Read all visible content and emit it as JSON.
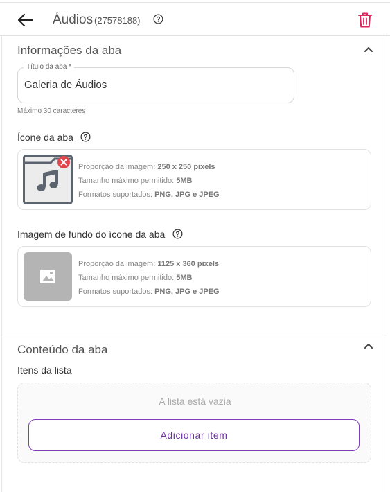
{
  "header": {
    "title": "Áudios",
    "id": "(27578188)"
  },
  "tab_info": {
    "title": "Informações da aba",
    "name_field": {
      "legend": "Título da aba *",
      "value": "Galeria de Áudios",
      "hint": "Máximo 30 caracteres"
    },
    "icon": {
      "label": "Ícone da aba",
      "specs": {
        "ratio_label": "Proporção da imagem: ",
        "ratio_value": "250 x 250 pixels",
        "size_label": "Tamanho máximo permitido: ",
        "size_value": "5MB",
        "formats_label": "Formatos suportados: ",
        "formats_value": "PNG, JPG e JPEG"
      }
    },
    "background": {
      "label": "Imagem de fundo do ícone da aba",
      "specs": {
        "ratio_label": "Proporção da imagem: ",
        "ratio_value": "1125 x 360 pixels",
        "size_label": "Tamanho máximo permitido: ",
        "size_value": "5MB",
        "formats_label": "Formatos suportados: ",
        "formats_value": "PNG, JPG e JPEG"
      }
    }
  },
  "tab_content": {
    "title": "Conteúdo da aba",
    "list_label": "Itens da lista",
    "empty_text": "A lista está vazia",
    "add_button": "Adicionar item"
  },
  "colors": {
    "accent": "#6d2fa5",
    "danger": "#e0245e",
    "remove_badge": "#e0474c"
  }
}
